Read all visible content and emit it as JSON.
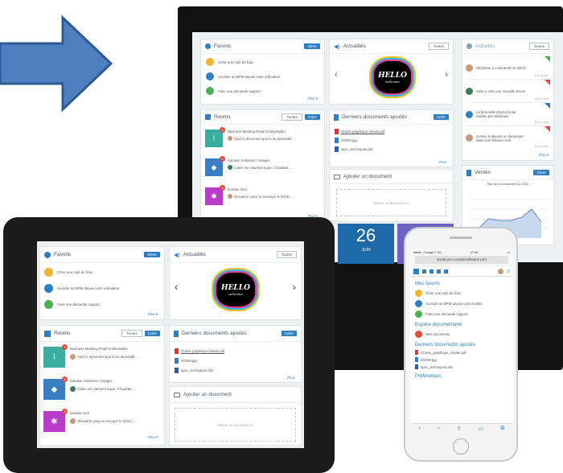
{
  "desktop": {
    "favoris": {
      "title": "Favoris",
      "add": "Gérer",
      "items": [
        "Créer une note de frais",
        "Accéder au BPM depuis votre ordinateur",
        "Faire une demande support"
      ],
      "more": "Plus ▾"
    },
    "actualites": {
      "title": "Actualités",
      "btn": "Toutes",
      "logo": "HELLO",
      "logo_sub": "welcome"
    },
    "activites": {
      "title": "Activités",
      "btn": "Toutes",
      "items": [
        {
          "text": "Stéphane a commenté un article",
          "time": "Il y a 1 min"
        },
        {
          "text": "Sofie a créé une nouvelle Room",
          "time": "Il y a 1 min"
        },
        {
          "text": "La demande d'achat à été validée par Stéphane",
          "time": "Il y a 1 min"
        },
        {
          "text": "Justine à déposé un document dans la le Dossier Avril",
          "time": "Il y a 1 min"
        }
      ],
      "more": "Plus ▾"
    },
    "rooms": {
      "title": "Rooms",
      "btn": "Toutes",
      "add": "Créer",
      "items": [
        {
          "name": "Business Meeting Retail Holdomaden",
          "msg": "Voici le document que tu as demandé …",
          "color": "#3aada0",
          "badge": "2"
        },
        {
          "name": "Solution Solutions / Usages",
          "msg": "L'idée est vraiment super, il faudrait …",
          "color": "#3a7fc4",
          "badge": "4"
        },
        {
          "name": "Dossier Avril",
          "msg": "@Justine, peux tu renvoyer le fichier …",
          "color": "#b93bc9",
          "badge": "3"
        }
      ],
      "more": "Plus ▾"
    },
    "docs": {
      "title": "Derniers documents ajoutés",
      "add": "Créer",
      "items": [
        "Charte graphique Visiale.pdf",
        "ZOOM.jpg",
        "spec_techniques.doc"
      ],
      "more": "Plus"
    },
    "upload": {
      "title": "Ajouter un document",
      "drop": "Glisser un document ici"
    },
    "ventes": {
      "title": "Ventes",
      "btn": "Gérer",
      "chart_title": "Etat des commandes Q1 2013"
    },
    "tile": {
      "day": "26",
      "month": "JUIN"
    }
  },
  "tablet": {
    "favoris": {
      "title": "Favoris",
      "add": "Gérer",
      "items": [
        "Créer une note de frais",
        "Accéder au BPM depuis votre ordinateur",
        "Faire une demande support"
      ],
      "more": "Plus ▾"
    },
    "actualites": {
      "title": "Actualités",
      "btn": "Toutes"
    },
    "rooms": {
      "title": "Rooms",
      "btn": "Toutes",
      "add": "Créer",
      "items": [
        {
          "name": "Business Meeting Retail Holdomaden",
          "msg": "Voici le document que tu as demandé …"
        },
        {
          "name": "Solution Solutions / Usages",
          "msg": "L'idée est vraiment super, il faudrait …"
        },
        {
          "name": "Dossier Avril",
          "msg": "@Justine, peux tu envoyer le fichier …"
        }
      ],
      "more": "Plus ▾"
    },
    "docs": {
      "title": "Derniers documents ajoutés",
      "add": "Créer",
      "items": [
        "Charte graphique Visiale.pdf",
        "ZOOM.jpg",
        "spec_techniques.doc"
      ],
      "more": "Plus"
    },
    "upload": {
      "title": "Ajouter un document",
      "drop": "Glisser un document ici"
    }
  },
  "phone": {
    "carrier": "●●●●○ Orange F  3G",
    "time": "17:46",
    "battery": "▭",
    "url": "social.jeco.creativsoftware.com",
    "favoris": {
      "title": "Mes favoris",
      "items": [
        "Créer une note de frais",
        "Accéder au BPM depuis votre mobile",
        "Faire une demande support"
      ]
    },
    "espace": {
      "title": "Espace documentaire",
      "item": "Mes documents"
    },
    "docs": {
      "title": "Derniers documents ajoutés",
      "items": [
        "Charte_graphique_Visiale.pdf",
        "ZOOM.jpg",
        "spec_techniques.doc"
      ]
    },
    "pref": {
      "title": "Préférences"
    }
  }
}
